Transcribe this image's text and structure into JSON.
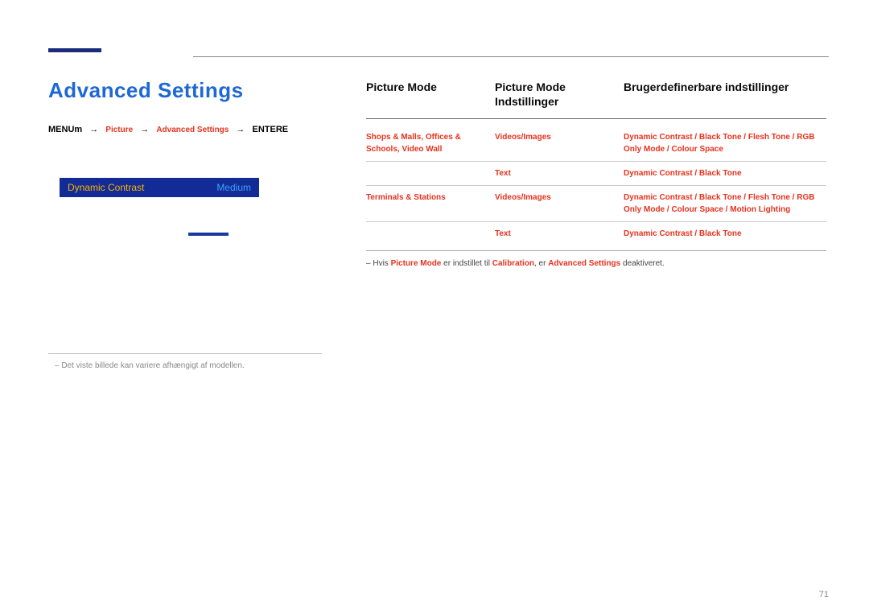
{
  "heading": "Advanced Settings",
  "breadcrumb": {
    "menu_prefix": "MENU",
    "menu_suffix": "m",
    "arrow": "→",
    "p1": "Picture",
    "p2": "Advanced Settings",
    "enter_prefix": "ENTER",
    "enter_suffix": "E"
  },
  "panel": {
    "item_label": "Dynamic Contrast",
    "item_value": "Medium"
  },
  "footnote": "Det viste billede kan variere afhængigt af modellen.",
  "table": {
    "hdr_mode": "Picture Mode",
    "hdr_set": "Picture Mode Indstillinger",
    "hdr_user": "Brugerdefinerbare indstillinger",
    "rows": [
      {
        "mode": "Shops & Malls, Offices & Schools, Video Wall",
        "set": "Videos/Images",
        "user": "Dynamic Contrast / Black Tone / Flesh Tone / RGB Only Mode / Colour Space"
      },
      {
        "mode": "",
        "set": "Text",
        "user": "Dynamic Contrast / Black Tone"
      },
      {
        "mode": "Terminals & Stations",
        "set": "Videos/Images",
        "user": "Dynamic Contrast / Black Tone / Flesh Tone / RGB Only Mode / Colour Space / Motion Lighting"
      },
      {
        "mode": "",
        "set": "Text",
        "user": "Dynamic Contrast / Black Tone"
      }
    ],
    "note_pre": "Hvis ",
    "note_b1": "Picture Mode",
    "note_mid": " er indstillet til ",
    "note_b2": "Calibration",
    "note_mid2": ", er ",
    "note_b3": "Advanced Settings",
    "note_post": " deaktiveret."
  },
  "page_no": "71"
}
